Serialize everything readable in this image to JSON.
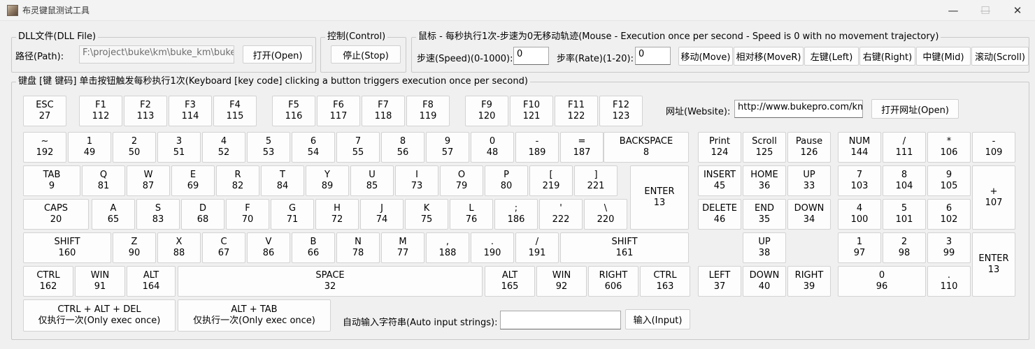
{
  "window": {
    "title": "布灵键鼠测试工具",
    "controls": [
      "—",
      "☐",
      "✕"
    ]
  },
  "dll": {
    "group_title": "DLL文件(DLL File)",
    "path_label": "路径(Path):",
    "path_value": "F:\\project\\buke\\km\\buke_km\\buke_km",
    "open_label": "打开(Open)"
  },
  "control": {
    "group_title": "控制(Control)",
    "stop_label": "停止(Stop)"
  },
  "mouse": {
    "group_title": "鼠标 - 每秒执行1次-步速为0无移动轨迹(Mouse - Execution once per second - Speed is 0 with no movement trajectory)",
    "speed_label": "步速(Speed)(0-1000):",
    "speed_value": "0",
    "rate_label": "步率(Rate)(1-20):",
    "rate_value": "0",
    "buttons": [
      "移动(Move)",
      "相对移(MoveR)",
      "左键(Left)",
      "右键(Right)",
      "中键(Mid)",
      "滚动(Scroll)"
    ]
  },
  "keyboard": {
    "group_title": "键盘 [键 键码] 单击按钮触发每秒执行1次(Keyboard [key code] clicking a button triggers execution once per second)",
    "website_label": "网址(Website):",
    "website_value": "http://www.bukepro.com/km",
    "open_site_label": "打开网址(Open)",
    "keys": [
      {
        "l": "ESC",
        "c": "27"
      },
      {
        "l": "F1",
        "c": "112"
      },
      {
        "l": "F2",
        "c": "113"
      },
      {
        "l": "F3",
        "c": "114"
      },
      {
        "l": "F4",
        "c": "115"
      },
      {
        "l": "F5",
        "c": "116"
      },
      {
        "l": "F6",
        "c": "117"
      },
      {
        "l": "F7",
        "c": "118"
      },
      {
        "l": "F8",
        "c": "119"
      },
      {
        "l": "F9",
        "c": "120"
      },
      {
        "l": "F10",
        "c": "121"
      },
      {
        "l": "F11",
        "c": "122"
      },
      {
        "l": "F12",
        "c": "123"
      },
      {
        "l": "~",
        "c": "192"
      },
      {
        "l": "1",
        "c": "49"
      },
      {
        "l": "2",
        "c": "50"
      },
      {
        "l": "3",
        "c": "51"
      },
      {
        "l": "4",
        "c": "52"
      },
      {
        "l": "5",
        "c": "53"
      },
      {
        "l": "6",
        "c": "54"
      },
      {
        "l": "7",
        "c": "55"
      },
      {
        "l": "8",
        "c": "56"
      },
      {
        "l": "9",
        "c": "57"
      },
      {
        "l": "0",
        "c": "48"
      },
      {
        "l": "-",
        "c": "189"
      },
      {
        "l": "=",
        "c": "187"
      },
      {
        "l": "BACKSPACE",
        "c": "8"
      },
      {
        "l": "TAB",
        "c": "9"
      },
      {
        "l": "Q",
        "c": "81"
      },
      {
        "l": "W",
        "c": "87"
      },
      {
        "l": "E",
        "c": "69"
      },
      {
        "l": "R",
        "c": "82"
      },
      {
        "l": "T",
        "c": "84"
      },
      {
        "l": "Y",
        "c": "89"
      },
      {
        "l": "U",
        "c": "85"
      },
      {
        "l": "I",
        "c": "73"
      },
      {
        "l": "O",
        "c": "79"
      },
      {
        "l": "P",
        "c": "80"
      },
      {
        "l": "[",
        "c": "219"
      },
      {
        "l": "]",
        "c": "221"
      },
      {
        "l": "ENTER",
        "c": "13"
      },
      {
        "l": "CAPS",
        "c": "20"
      },
      {
        "l": "A",
        "c": "65"
      },
      {
        "l": "S",
        "c": "83"
      },
      {
        "l": "D",
        "c": "68"
      },
      {
        "l": "F",
        "c": "70"
      },
      {
        "l": "G",
        "c": "71"
      },
      {
        "l": "H",
        "c": "72"
      },
      {
        "l": "J",
        "c": "74"
      },
      {
        "l": "K",
        "c": "75"
      },
      {
        "l": "L",
        "c": "76"
      },
      {
        "l": ";",
        "c": "186"
      },
      {
        "l": "'",
        "c": "222"
      },
      {
        "l": "\\",
        "c": "220"
      },
      {
        "l": "SHIFT",
        "c": "160"
      },
      {
        "l": "Z",
        "c": "90"
      },
      {
        "l": "X",
        "c": "88"
      },
      {
        "l": "C",
        "c": "67"
      },
      {
        "l": "V",
        "c": "86"
      },
      {
        "l": "B",
        "c": "66"
      },
      {
        "l": "N",
        "c": "78"
      },
      {
        "l": "M",
        "c": "77"
      },
      {
        "l": ",",
        "c": "188"
      },
      {
        "l": ".",
        "c": "190"
      },
      {
        "l": "/",
        "c": "191"
      },
      {
        "l": "SHIFT",
        "c": "161"
      },
      {
        "l": "CTRL",
        "c": "162"
      },
      {
        "l": "WIN",
        "c": "91"
      },
      {
        "l": "ALT",
        "c": "164"
      },
      {
        "l": "SPACE",
        "c": "32"
      },
      {
        "l": "ALT",
        "c": "165"
      },
      {
        "l": "WIN",
        "c": "92"
      },
      {
        "l": "RIGHT",
        "c": "606"
      },
      {
        "l": "CTRL",
        "c": "163"
      },
      {
        "l": "Print",
        "c": "124"
      },
      {
        "l": "Scroll",
        "c": "125"
      },
      {
        "l": "Pause",
        "c": "126"
      },
      {
        "l": "INSERT",
        "c": "45"
      },
      {
        "l": "HOME",
        "c": "36"
      },
      {
        "l": "UP",
        "c": "33"
      },
      {
        "l": "DELETE",
        "c": "46"
      },
      {
        "l": "END",
        "c": "35"
      },
      {
        "l": "DOWN",
        "c": "34"
      },
      {
        "l": "UP",
        "c": "38"
      },
      {
        "l": "LEFT",
        "c": "37"
      },
      {
        "l": "DOWN",
        "c": "40"
      },
      {
        "l": "RIGHT",
        "c": "39"
      },
      {
        "l": "NUM",
        "c": "144"
      },
      {
        "l": "/",
        "c": "111"
      },
      {
        "l": "*",
        "c": "106"
      },
      {
        "l": "-",
        "c": "109"
      },
      {
        "l": "7",
        "c": "103"
      },
      {
        "l": "8",
        "c": "104"
      },
      {
        "l": "9",
        "c": "105"
      },
      {
        "l": "+",
        "c": "107"
      },
      {
        "l": "4",
        "c": "100"
      },
      {
        "l": "5",
        "c": "101"
      },
      {
        "l": "6",
        "c": "102"
      },
      {
        "l": "1",
        "c": "97"
      },
      {
        "l": "2",
        "c": "98"
      },
      {
        "l": "3",
        "c": "99"
      },
      {
        "l": "ENTER",
        "c": "13"
      },
      {
        "l": "0",
        "c": "96"
      },
      {
        "l": ".",
        "c": "110"
      }
    ],
    "combos": [
      {
        "l1": "CTRL + ALT + DEL",
        "l2": "仅执行一次(Only exec once)"
      },
      {
        "l1": "ALT + TAB",
        "l2": "仅执行一次(Only exec once)"
      }
    ],
    "auto_input_label": "自动输入字符串(Auto input strings):",
    "auto_input_value": "",
    "input_label": "输入(Input)"
  }
}
